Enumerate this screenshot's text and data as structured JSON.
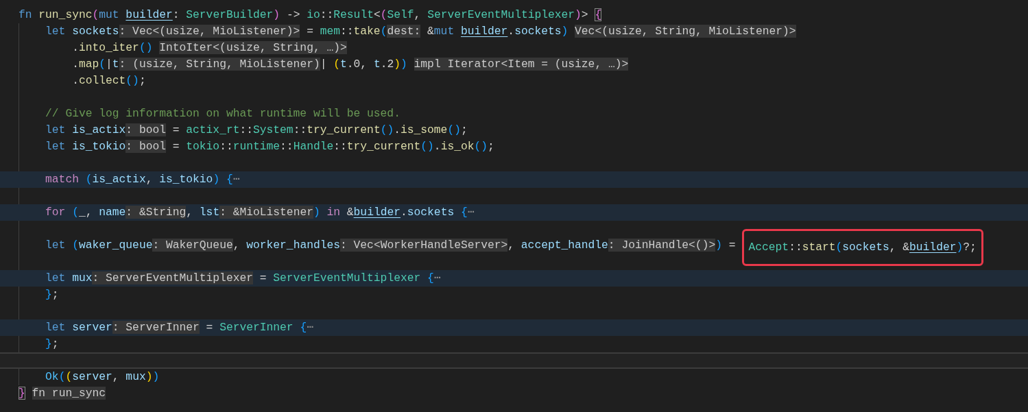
{
  "editor": {
    "lines": [
      {
        "folded": false,
        "current": false,
        "tokens": [
          {
            "kind": "kw",
            "text": "fn "
          },
          {
            "kind": "fn",
            "text": "run_sync"
          },
          {
            "kind": "b2",
            "text": "("
          },
          {
            "kind": "kw",
            "text": "mut "
          },
          {
            "kind": "mv",
            "text": "builder"
          },
          {
            "kind": "tx",
            "text": ": "
          },
          {
            "kind": "ty",
            "text": "ServerBuilder"
          },
          {
            "kind": "b2",
            "text": ")"
          },
          {
            "kind": "tx",
            "text": " -> "
          },
          {
            "kind": "ty",
            "text": "io"
          },
          {
            "kind": "tx",
            "text": "::"
          },
          {
            "kind": "ty",
            "text": "Result"
          },
          {
            "kind": "tx",
            "text": "<"
          },
          {
            "kind": "b2",
            "text": "("
          },
          {
            "kind": "ty",
            "text": "Self"
          },
          {
            "kind": "tx",
            "text": ", "
          },
          {
            "kind": "ty",
            "text": "ServerEventMultiplexer"
          },
          {
            "kind": "b2",
            "text": ")"
          },
          {
            "kind": "tx",
            "text": "> "
          },
          {
            "kind": "bm",
            "text": "{"
          }
        ],
        "children": [
          {
            "folded": false,
            "current": false,
            "tokens": [
              {
                "kind": "kw",
                "text": "let "
              },
              {
                "kind": "var",
                "text": "sockets"
              },
              {
                "kind": "hint",
                "text": ": Vec<(usize, MioListener)>"
              },
              {
                "kind": "tx",
                "text": " = "
              },
              {
                "kind": "ty",
                "text": "mem"
              },
              {
                "kind": "tx",
                "text": "::"
              },
              {
                "kind": "fn",
                "text": "take"
              },
              {
                "kind": "b3",
                "text": "("
              },
              {
                "kind": "hint",
                "text": "dest:"
              },
              {
                "kind": "tx",
                "text": " &"
              },
              {
                "kind": "kw",
                "text": "mut "
              },
              {
                "kind": "mv",
                "text": "builder"
              },
              {
                "kind": "tx",
                "text": "."
              },
              {
                "kind": "var",
                "text": "sockets"
              },
              {
                "kind": "b3",
                "text": ") "
              },
              {
                "kind": "hint",
                "text": "Vec<(usize, String, MioListener)>"
              }
            ],
            "children": [
              {
                "folded": false,
                "current": false,
                "tokens": [
                  {
                    "kind": "tx",
                    "text": "."
                  },
                  {
                    "kind": "fn",
                    "text": "into_iter"
                  },
                  {
                    "kind": "b3",
                    "text": "() "
                  },
                  {
                    "kind": "hint",
                    "text": "IntoIter<(usize, String, …)>"
                  }
                ]
              },
              {
                "folded": false,
                "current": false,
                "tokens": [
                  {
                    "kind": "tx",
                    "text": "."
                  },
                  {
                    "kind": "fn",
                    "text": "map"
                  },
                  {
                    "kind": "b3",
                    "text": "("
                  },
                  {
                    "kind": "tx",
                    "text": "|"
                  },
                  {
                    "kind": "var",
                    "text": "t"
                  },
                  {
                    "kind": "hint",
                    "text": ": (usize, String, MioListener)"
                  },
                  {
                    "kind": "tx",
                    "text": "| "
                  },
                  {
                    "kind": "b1",
                    "text": "("
                  },
                  {
                    "kind": "var",
                    "text": "t"
                  },
                  {
                    "kind": "tx",
                    "text": ".0, "
                  },
                  {
                    "kind": "var",
                    "text": "t"
                  },
                  {
                    "kind": "tx",
                    "text": ".2"
                  },
                  {
                    "kind": "b1",
                    "text": ")"
                  },
                  {
                    "kind": "b3",
                    "text": ") "
                  },
                  {
                    "kind": "hint",
                    "text": "impl Iterator<Item = (usize, …)>"
                  }
                ]
              },
              {
                "folded": false,
                "current": false,
                "tokens": [
                  {
                    "kind": "tx",
                    "text": "."
                  },
                  {
                    "kind": "fn",
                    "text": "collect"
                  },
                  {
                    "kind": "b3",
                    "text": "()"
                  },
                  {
                    "kind": "tx",
                    "text": ";"
                  }
                ]
              }
            ]
          },
          {
            "folded": false,
            "current": false
          },
          {
            "folded": false,
            "current": false,
            "tokens": [
              {
                "kind": "cm",
                "text": "// Give log information on what runtime will be used."
              }
            ]
          },
          {
            "folded": false,
            "current": false,
            "tokens": [
              {
                "kind": "kw",
                "text": "let "
              },
              {
                "kind": "var",
                "text": "is_actix"
              },
              {
                "kind": "hint",
                "text": ": bool"
              },
              {
                "kind": "tx",
                "text": " = "
              },
              {
                "kind": "ty",
                "text": "actix_rt"
              },
              {
                "kind": "tx",
                "text": "::"
              },
              {
                "kind": "ty",
                "text": "System"
              },
              {
                "kind": "tx",
                "text": "::"
              },
              {
                "kind": "fn",
                "text": "try_current"
              },
              {
                "kind": "b3",
                "text": "()"
              },
              {
                "kind": "tx",
                "text": "."
              },
              {
                "kind": "fn",
                "text": "is_some"
              },
              {
                "kind": "b3",
                "text": "()"
              },
              {
                "kind": "tx",
                "text": ";"
              }
            ]
          },
          {
            "folded": false,
            "current": false,
            "tokens": [
              {
                "kind": "kw",
                "text": "let "
              },
              {
                "kind": "var",
                "text": "is_tokio"
              },
              {
                "kind": "hint",
                "text": ": bool"
              },
              {
                "kind": "tx",
                "text": " = "
              },
              {
                "kind": "ty",
                "text": "tokio"
              },
              {
                "kind": "tx",
                "text": "::"
              },
              {
                "kind": "ty",
                "text": "runtime"
              },
              {
                "kind": "tx",
                "text": "::"
              },
              {
                "kind": "ty",
                "text": "Handle"
              },
              {
                "kind": "tx",
                "text": "::"
              },
              {
                "kind": "fn",
                "text": "try_current"
              },
              {
                "kind": "b3",
                "text": "()"
              },
              {
                "kind": "tx",
                "text": "."
              },
              {
                "kind": "fn",
                "text": "is_ok"
              },
              {
                "kind": "b3",
                "text": "()"
              },
              {
                "kind": "tx",
                "text": ";"
              }
            ]
          },
          {
            "folded": false,
            "current": false
          },
          {
            "folded": true,
            "current": false,
            "tokens": [
              {
                "kind": "ctl",
                "text": "match "
              },
              {
                "kind": "b3",
                "text": "("
              },
              {
                "kind": "var",
                "text": "is_actix"
              },
              {
                "kind": "tx",
                "text": ", "
              },
              {
                "kind": "var",
                "text": "is_tokio"
              },
              {
                "kind": "b3",
                "text": ") {"
              },
              {
                "kind": "fold",
                "text": "⋯"
              }
            ]
          },
          {
            "folded": false,
            "current": false
          },
          {
            "folded": true,
            "current": false,
            "tokens": [
              {
                "kind": "ctl",
                "text": "for "
              },
              {
                "kind": "b3",
                "text": "("
              },
              {
                "kind": "tx",
                "text": "_, "
              },
              {
                "kind": "var",
                "text": "name"
              },
              {
                "kind": "hint",
                "text": ": &String"
              },
              {
                "kind": "tx",
                "text": ", "
              },
              {
                "kind": "var",
                "text": "lst"
              },
              {
                "kind": "hint",
                "text": ": &MioListener"
              },
              {
                "kind": "b3",
                "text": ")"
              },
              {
                "kind": "ctl",
                "text": " in"
              },
              {
                "kind": "tx",
                "text": " &"
              },
              {
                "kind": "mv",
                "text": "builder"
              },
              {
                "kind": "tx",
                "text": "."
              },
              {
                "kind": "var",
                "text": "sockets"
              },
              {
                "kind": "b3",
                "text": " {"
              },
              {
                "kind": "fold",
                "text": "⋯"
              }
            ]
          },
          {
            "folded": false,
            "current": false
          },
          {
            "folded": false,
            "current": false,
            "tokens": [
              {
                "kind": "kw",
                "text": "let "
              },
              {
                "kind": "b3",
                "text": "("
              },
              {
                "kind": "var",
                "text": "waker_queue"
              },
              {
                "kind": "hint",
                "text": ": WakerQueue"
              },
              {
                "kind": "tx",
                "text": ", "
              },
              {
                "kind": "var",
                "text": "worker_handles"
              },
              {
                "kind": "hint",
                "text": ": Vec<WorkerHandleServer>"
              },
              {
                "kind": "tx",
                "text": ", "
              },
              {
                "kind": "var",
                "text": "accept_handle"
              },
              {
                "kind": "hint",
                "text": ": JoinHandle<()>"
              },
              {
                "kind": "b3",
                "text": ")"
              },
              {
                "kind": "tx",
                "text": " ="
              }
            ],
            "annotation": {
              "tokens": [
                {
                  "kind": "ty",
                  "text": "Accept"
                },
                {
                  "kind": "tx",
                  "text": "::"
                },
                {
                  "kind": "fn",
                  "text": "start"
                },
                {
                  "kind": "b3",
                  "text": "("
                },
                {
                  "kind": "var",
                  "text": "sockets"
                },
                {
                  "kind": "tx",
                  "text": ", &"
                },
                {
                  "kind": "mv",
                  "text": "builder"
                },
                {
                  "kind": "b3",
                  "text": ")"
                },
                {
                  "kind": "tx",
                  "text": "?;"
                }
              ]
            }
          },
          {
            "folded": false,
            "current": false
          },
          {
            "folded": true,
            "current": false,
            "tokens": [
              {
                "kind": "kw",
                "text": "let "
              },
              {
                "kind": "var",
                "text": "mux"
              },
              {
                "kind": "hint",
                "text": ": ServerEventMultiplexer"
              },
              {
                "kind": "tx",
                "text": " = "
              },
              {
                "kind": "ty",
                "text": "ServerEventMultiplexer"
              },
              {
                "kind": "b3",
                "text": " {"
              },
              {
                "kind": "fold",
                "text": "⋯"
              }
            ]
          },
          {
            "folded": false,
            "current": false,
            "tokens": [
              {
                "kind": "b3",
                "text": "}"
              },
              {
                "kind": "tx",
                "text": ";"
              }
            ]
          },
          {
            "folded": false,
            "current": false
          },
          {
            "folded": true,
            "current": false,
            "tokens": [
              {
                "kind": "kw",
                "text": "let "
              },
              {
                "kind": "var",
                "text": "server"
              },
              {
                "kind": "hint",
                "text": ": ServerInner"
              },
              {
                "kind": "tx",
                "text": " = "
              },
              {
                "kind": "ty",
                "text": "ServerInner"
              },
              {
                "kind": "b3",
                "text": " {"
              },
              {
                "kind": "fold",
                "text": "⋯"
              }
            ]
          },
          {
            "folded": false,
            "current": false,
            "tokens": [
              {
                "kind": "b3",
                "text": "}"
              },
              {
                "kind": "tx",
                "text": ";"
              }
            ]
          },
          {
            "folded": false,
            "current": true
          },
          {
            "folded": false,
            "current": false,
            "tokens": [
              {
                "kind": "ok",
                "text": "Ok"
              },
              {
                "kind": "b3",
                "text": "("
              },
              {
                "kind": "b1",
                "text": "("
              },
              {
                "kind": "var",
                "text": "server"
              },
              {
                "kind": "tx",
                "text": ", "
              },
              {
                "kind": "var",
                "text": "mux"
              },
              {
                "kind": "b1",
                "text": ")"
              },
              {
                "kind": "b3",
                "text": ")"
              }
            ]
          }
        ]
      },
      {
        "folded": false,
        "current": false,
        "tokens": [
          {
            "kind": "bm",
            "text": "}"
          },
          {
            "kind": "hint",
            "text": "fn run_sync"
          }
        ]
      }
    ]
  }
}
